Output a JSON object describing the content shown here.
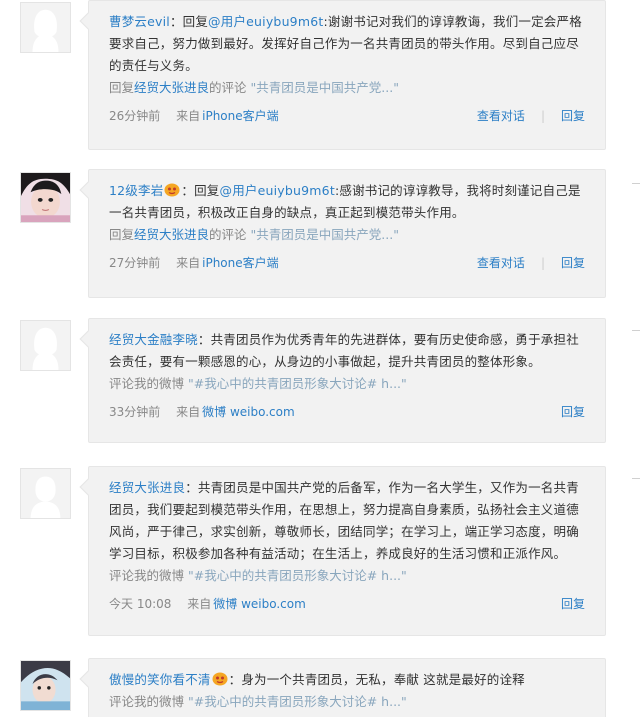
{
  "comments": [
    {
      "author": "曹梦云evil",
      "badge": false,
      "body_prefix": "：回复",
      "mention": "@用户euiybu9m6t",
      "body": ":谢谢书记对我们的谆谆教诲，我们一定会严格要求自己，努力做到最好。发挥好自己作为一名共青团员的带头作用。尽到自己应尽的责任与义务。",
      "ref_prefix": "回复",
      "ref_user": "经贸大张进良",
      "ref_mid": "的评论",
      "ref_quote": "\"共青团员是中国共产党...\"",
      "time": "26分钟前",
      "source_prefix": "来自",
      "source": "iPhone客户端",
      "view_label": "查看对话",
      "reply_label": "回复",
      "avatar_icon": "default-female-avatar-icon"
    },
    {
      "author": "12级李岩",
      "badge": true,
      "body_prefix": "：回复",
      "mention": "@用户euiybu9m6t",
      "body": ":感谢书记的谆谆教导，我将时刻谨记自己是一名共青团员，积极改正自身的缺点，真正起到模范带头作用。",
      "ref_prefix": "回复",
      "ref_user": "经贸大张进良",
      "ref_mid": "的评论",
      "ref_quote": "\"共青团员是中国共产党...\"",
      "time": "27分钟前",
      "source_prefix": "来自",
      "source": "iPhone客户端",
      "view_label": "查看对话",
      "reply_label": "回复",
      "avatar_icon": "user-photo-avatar-icon"
    },
    {
      "author": "经贸大金融李晓",
      "badge": false,
      "body_prefix": "：",
      "mention": "",
      "body": "共青团员作为优秀青年的先进群体，要有历史使命感，勇于承担社会责任，要有一颗感恩的心，从身边的小事做起，提升共青团员的整体形象。",
      "ref_prefix": "评论我的微博",
      "ref_user": "",
      "ref_mid": "",
      "ref_quote": "\"#我心中的共青团员形象大讨论# h...\"",
      "time": "33分钟前",
      "source_prefix": "来自",
      "source": "微博 weibo.com",
      "view_label": "",
      "reply_label": "回复",
      "avatar_icon": "default-female-avatar-icon"
    },
    {
      "author": "经贸大张进良",
      "badge": false,
      "body_prefix": "：",
      "mention": "",
      "body": "共青团员是中国共产党的后备军，作为一名大学生，又作为一名共青团员，我们要起到模范带头作用，在思想上，努力提高自身素质，弘扬社会主义道德风尚，严于律己，求实创新，尊敬师长，团结同学；在学习上，端正学习态度，明确学习目标，积极参加各种有益活动；在生活上，养成良好的生活习惯和正派作风。",
      "ref_prefix": "评论我的微博",
      "ref_user": "",
      "ref_mid": "",
      "ref_quote": "\"#我心中的共青团员形象大讨论# h...\"",
      "time": "今天 10:08",
      "source_prefix": "来自",
      "source": "微博 weibo.com",
      "view_label": "",
      "reply_label": "回复",
      "avatar_icon": "default-male-avatar-icon"
    },
    {
      "author": "傲慢的笑你看不清",
      "badge": true,
      "body_prefix": "：",
      "mention": "",
      "body": "身为一个共青团员，无私，奉献 这就是最好的诠释",
      "ref_prefix": "评论我的微博",
      "ref_user": "",
      "ref_mid": "",
      "ref_quote": "\"#我心中的共青团员形象大讨论# h...\"",
      "time": "",
      "source_prefix": "",
      "source": "",
      "view_label": "",
      "reply_label": "",
      "avatar_icon": "user-photo-avatar-icon"
    }
  ],
  "colors": {
    "link": "#2c7fc6",
    "bubble_bg": "#f2f2f2",
    "quote": "#89a6bd",
    "grey_text": "#888888"
  }
}
